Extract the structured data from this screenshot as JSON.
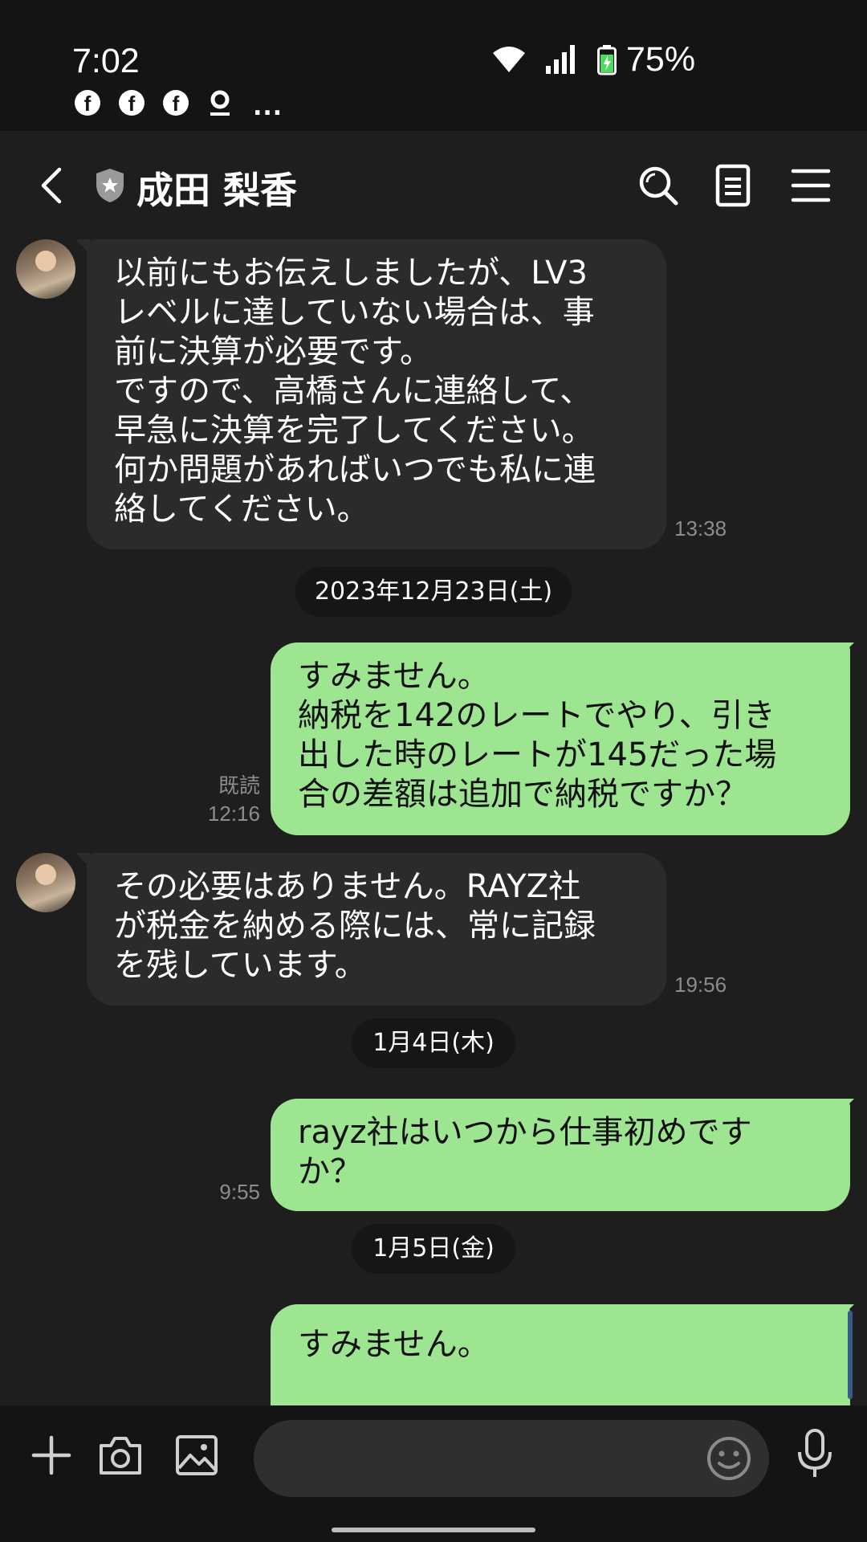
{
  "status_bar": {
    "time": "7:02",
    "notifications": [
      "facebook-icon",
      "facebook-icon",
      "facebook-icon",
      "app-icon"
    ],
    "more": "...",
    "battery_percent": "75%"
  },
  "header": {
    "contact_name": "成田 梨香",
    "icons": [
      "back-icon",
      "shield-icon",
      "search-icon",
      "notes-icon",
      "menu-icon"
    ]
  },
  "messages": {
    "m1": {
      "text": "以前にもお伝えしましたが、LV3\nレベルに達していない場合は、事\n前に決算が必要です。\nですので、高橋さんに連絡して、\n早急に決算を完了してください。\n何か問題があればいつでも私に連\n絡してください。",
      "time": "13:38"
    },
    "date1": "2023年12月23日(土)",
    "m2": {
      "text": "すみません。\n納税を142のレートでやり、引き\n出した時のレートが145だった場\n合の差額は追加で納税ですか？",
      "read": "既読",
      "time": "12:16"
    },
    "m3": {
      "text": "その必要はありません。RAYZ社\nが税金を納める際には、常に記録\nを残しています。",
      "time": "19:56"
    },
    "date2": "1月4日(木)",
    "m4": {
      "text": "rayz社はいつから仕事初めです\nか？",
      "time": "9:55"
    },
    "date3": "1月5日(金)",
    "m5": {
      "text": "すみません。"
    }
  },
  "input": {
    "placeholder": ""
  },
  "colors": {
    "outgoing_bubble": "#9ee591",
    "incoming_bubble": "#2b2b2b",
    "background": "#1e1e1e"
  }
}
